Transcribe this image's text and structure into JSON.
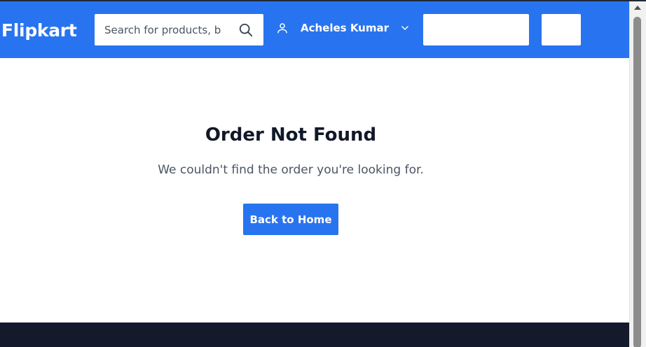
{
  "header": {
    "logo": "Flipkart",
    "search": {
      "placeholder": "Search for products, brands and more",
      "value": ""
    },
    "user": {
      "name": "Acheles Kumar"
    },
    "colors": {
      "brand": "#2874f0"
    }
  },
  "main": {
    "title": "Order Not Found",
    "message": "We couldn't find the order you're looking for.",
    "back_button_label": "Back to Home"
  },
  "icons": {
    "search": "search-icon",
    "user": "user-icon",
    "chevron": "chevron-down-icon"
  }
}
